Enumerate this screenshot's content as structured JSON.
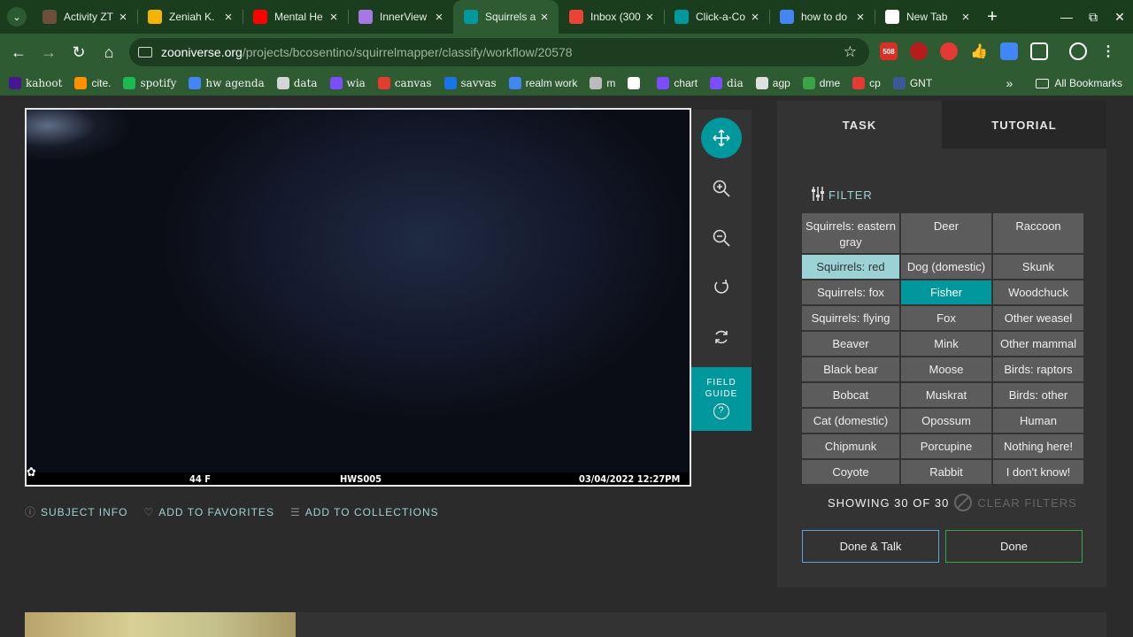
{
  "browser": {
    "tabs": [
      {
        "title": "Activity ZT",
        "icon_color": "#6b4f3a",
        "active": false
      },
      {
        "title": "Zeniah K.",
        "icon_color": "#f4b400",
        "active": false
      },
      {
        "title": "Mental He",
        "icon_color": "#ff0000",
        "active": false
      },
      {
        "title": "InnerView",
        "icon_color": "#a777e3",
        "active": false
      },
      {
        "title": "Squirrels a",
        "icon_color": "#00979d",
        "active": true
      },
      {
        "title": "Inbox (300",
        "icon_color": "#ea4335",
        "active": false
      },
      {
        "title": "Click-a-Co",
        "icon_color": "#00979d",
        "active": false
      },
      {
        "title": "how to do",
        "icon_color": "#4285f4",
        "active": false
      },
      {
        "title": "New Tab",
        "icon_color": "#ffffff",
        "active": false
      }
    ],
    "url_domain": "zooniverse.org",
    "url_path": "/projects/bcosentino/squirrelmapper/classify/workflow/20578",
    "extension_badge": "508",
    "bookmarks": [
      {
        "label": "kahoot",
        "color": "#46178f",
        "serif": true
      },
      {
        "label": "cite.",
        "color": "#ff9100",
        "serif": false
      },
      {
        "label": "spotify",
        "color": "#1db954",
        "serif": true
      },
      {
        "label": "hw agenda",
        "color": "#4285f4",
        "serif": true
      },
      {
        "label": "data",
        "color": "#d4d4d4",
        "serif": true
      },
      {
        "label": "wia",
        "color": "#7c4dff",
        "serif": true
      },
      {
        "label": "canvas",
        "color": "#e13c2e",
        "serif": true
      },
      {
        "label": "savvas",
        "color": "#1a73e8",
        "serif": true
      },
      {
        "label": "realm work",
        "color": "#4285f4",
        "serif": false
      },
      {
        "label": "m",
        "color": "#bbbbbb",
        "serif": false
      },
      {
        "label": "",
        "color": "#ffffff",
        "serif": false
      },
      {
        "label": "chart",
        "color": "#7c4dff",
        "serif": false
      },
      {
        "label": "dia",
        "color": "#7c4dff",
        "serif": true
      },
      {
        "label": "agp",
        "color": "#e0e0e0",
        "serif": false
      },
      {
        "label": "dme",
        "color": "#3aa34b",
        "serif": false
      },
      {
        "label": "cp",
        "color": "#e53935",
        "serif": false
      },
      {
        "label": "GNT",
        "color": "#3b5998",
        "serif": false
      }
    ],
    "all_bookmarks": "All Bookmarks"
  },
  "subject": {
    "temp": "44 F",
    "camera_id": "HWS005",
    "timestamp": "03/04/2022  12:27PM"
  },
  "tools": {
    "move_icon": "move-icon",
    "zoom_in_icon": "zoom-in-icon",
    "zoom_out_icon": "zoom-out-icon",
    "rotate_icon": "rotate-icon",
    "reset_icon": "reset-icon",
    "field_guide_line1": "FIELD",
    "field_guide_line2": "GUIDE",
    "field_guide_q": "?"
  },
  "meta": {
    "subject_info": "SUBJECT INFO",
    "add_favorites": "ADD TO FAVORITES",
    "add_collections": "ADD TO COLLECTIONS"
  },
  "task": {
    "tab_task": "TASK",
    "tab_tutorial": "TUTORIAL",
    "filter": "FILTER",
    "choices": [
      "Squirrels: eastern gray",
      "Deer",
      "Raccoon",
      "Squirrels: red",
      "Dog (domestic)",
      "Skunk",
      "Squirrels: fox",
      "Fisher",
      "Woodchuck",
      "Squirrels: flying",
      "Fox",
      "Other weasel",
      "Beaver",
      "Mink",
      "Other mammal",
      "Black bear",
      "Moose",
      "Birds: raptors",
      "Bobcat",
      "Muskrat",
      "Birds: other",
      "Cat (domestic)",
      "Opossum",
      "Human",
      "Chipmunk",
      "Porcupine",
      "Nothing here!",
      "Coyote",
      "Rabbit",
      "I don't know!"
    ],
    "showing": "SHOWING 30 OF 30",
    "clear_filters": "CLEAR FILTERS",
    "done_talk": "Done & Talk",
    "done": "Done"
  }
}
